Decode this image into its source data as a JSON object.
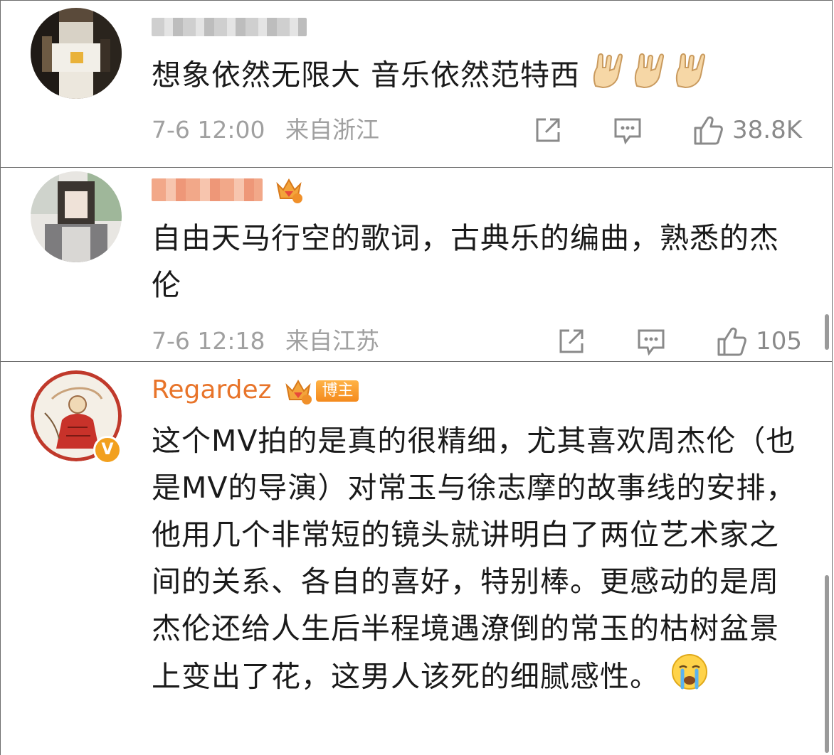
{
  "comments": [
    {
      "username": "",
      "text": "想象依然无限大 音乐依然范特西",
      "emoji": "rock-hand-emoji",
      "time": "7-6 12:00",
      "location": "来自浙江",
      "likes": "38.8K"
    },
    {
      "username": "",
      "text": "自由天马行空的歌词，古典乐的编曲，熟悉的杰伦",
      "time": "7-6 12:18",
      "location": "来自江苏",
      "likes": "105",
      "badge_level": "6"
    },
    {
      "username": "Regardez",
      "badge_level": "7",
      "badge_label": "博主",
      "text": "这个MV拍的是真的很精细，尤其喜欢周杰伦（也是MV的导演）对常玉与徐志摩的故事线的安排，他用几个非常短的镜头就讲明白了两位艺术家之间的关系、各自的喜好，特别棒。更感动的是周杰伦还给人生后半程境遇潦倒的常玉的枯树盆景上变出了花，这男人该死的细腻感性。",
      "emoji": "crying-face-emoji",
      "verified_mark": "V"
    }
  ],
  "colors": {
    "username_accent": "#e8742a",
    "meta_gray": "#a0a0a0",
    "border": "#6e6e6e"
  }
}
